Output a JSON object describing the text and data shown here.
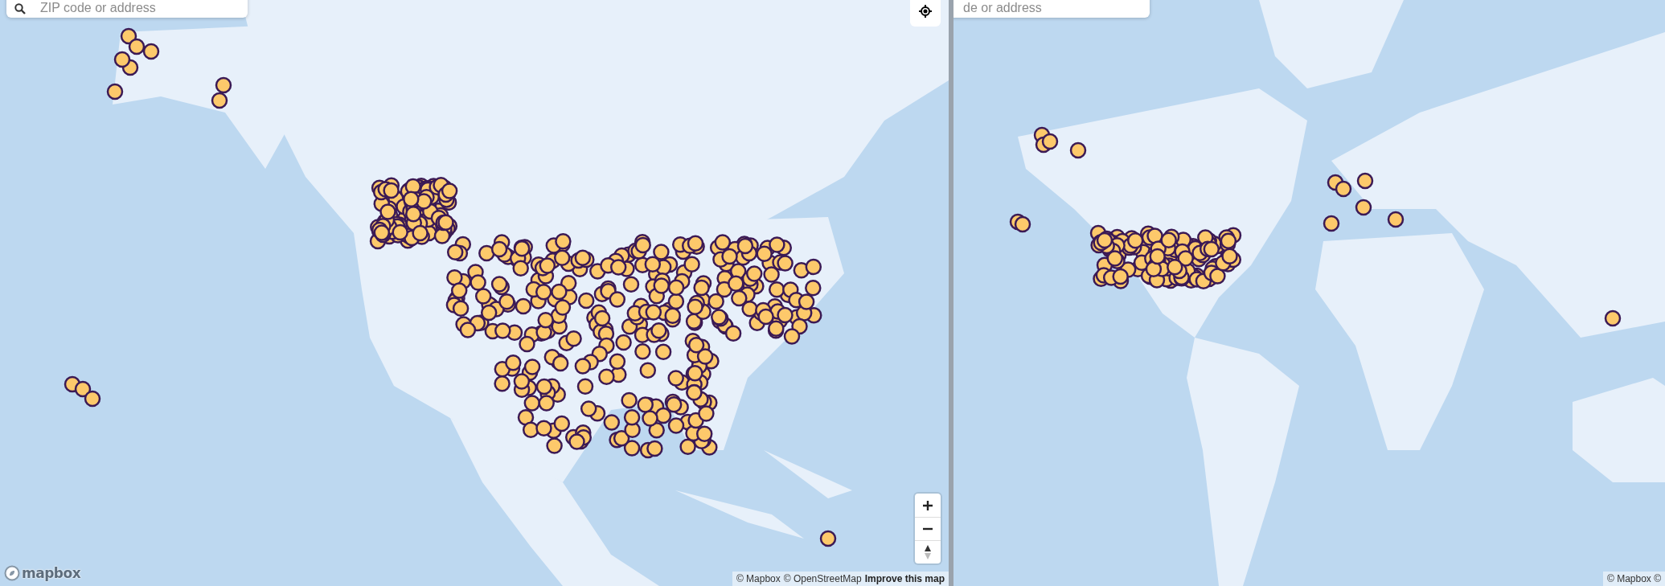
{
  "maps": [
    {
      "search": {
        "placeholder": "ZIP code or address"
      },
      "logo": "mapbox",
      "attribution": [
        {
          "kind": "credit",
          "text": "© Mapbox"
        },
        {
          "kind": "credit",
          "text": "© OpenStreetMap"
        },
        {
          "kind": "feedback",
          "text": "Improve this map"
        }
      ]
    },
    {
      "search": {
        "placeholder": "de or address"
      },
      "attribution": [
        {
          "kind": "credit",
          "text": "© Mapbox ©"
        }
      ]
    }
  ]
}
